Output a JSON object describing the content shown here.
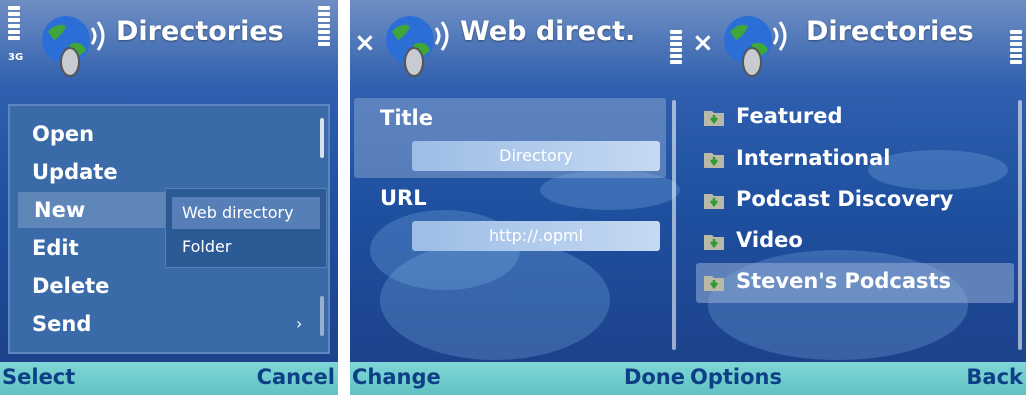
{
  "screens": [
    {
      "title": "Directories",
      "menu": [
        "Open",
        "Update",
        "New",
        "Edit",
        "Delete",
        "Send"
      ],
      "submenu": [
        "Web directory",
        "Folder"
      ],
      "submenu_arrow": "›",
      "softkeys": {
        "left": "Select",
        "right": "Cancel"
      }
    },
    {
      "title": "Web direct.",
      "close": "×",
      "fields": [
        {
          "label": "Title",
          "value": "Directory"
        },
        {
          "label": "URL",
          "value": "http://.opml"
        }
      ],
      "softkeys": {
        "left": "Change",
        "right": "Done"
      }
    },
    {
      "title": "Directories",
      "close": "×",
      "items": [
        "Featured",
        "International",
        "Podcast Discovery",
        "Video",
        "Steven's Podcasts"
      ],
      "softkeys": {
        "left": "Options",
        "right": "Back"
      }
    }
  ],
  "status": {
    "network": "3G"
  },
  "icons": {
    "app": "podcast-globe-icon",
    "folder": "folder-download-icon"
  },
  "colors": {
    "accent": "#0d3f86",
    "softkey_bar": "#6ec9cb",
    "highlight": "#5f86b9"
  }
}
